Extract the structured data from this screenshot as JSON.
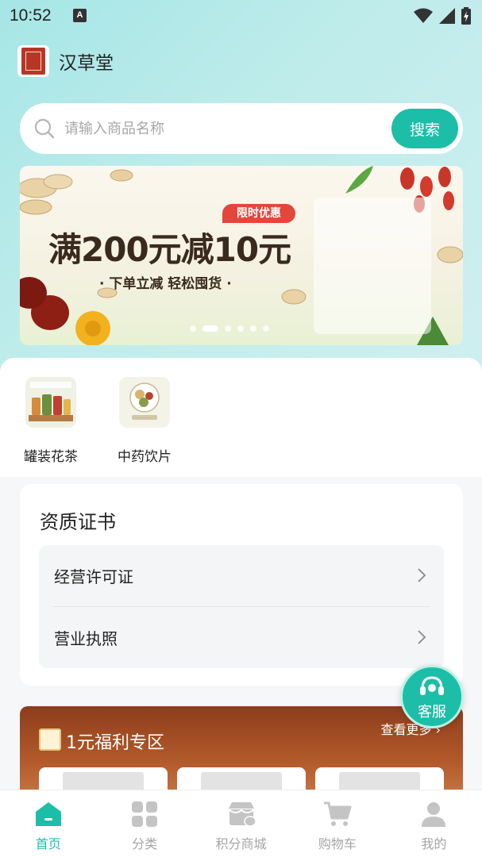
{
  "status_bar": {
    "time": "10:52",
    "notification_letter": "A"
  },
  "header": {
    "title": "汉草堂"
  },
  "search": {
    "placeholder": "请输入商品名称",
    "button_label": "搜索"
  },
  "banner": {
    "badge": "限时优惠",
    "headline": "满200元减10元",
    "subline": "· 下单立减 轻松囤货 ·",
    "slide_count": 6,
    "active_slide": 2
  },
  "categories": [
    {
      "label": "罐装花茶"
    },
    {
      "label": "中药饮片"
    }
  ],
  "certificates": {
    "title": "资质证书",
    "items": [
      {
        "label": "经营许可证"
      },
      {
        "label": "营业执照"
      }
    ]
  },
  "customer_service": {
    "label": "客服"
  },
  "welfare": {
    "title": "1元福利专区",
    "more_label": "查看更多"
  },
  "tabs": [
    {
      "label": "首页",
      "icon": "home-icon",
      "active": true
    },
    {
      "label": "分类",
      "icon": "category-icon",
      "active": false
    },
    {
      "label": "积分商城",
      "icon": "points-mall-icon",
      "active": false
    },
    {
      "label": "购物车",
      "icon": "cart-icon",
      "active": false
    },
    {
      "label": "我的",
      "icon": "user-icon",
      "active": false
    }
  ],
  "colors": {
    "accent": "#1dbea8",
    "banner_badge": "#e4463a",
    "tab_inactive": "#a5a5a5"
  }
}
